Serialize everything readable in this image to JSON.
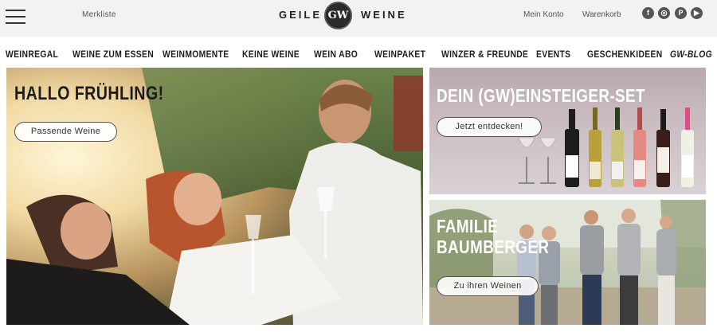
{
  "header": {
    "wishlist_label": "Merkliste",
    "logo_left": "GEILE",
    "logo_badge": "GW",
    "logo_right": "WEINE",
    "account_label": "Mein Konto",
    "cart_label": "Warenkorb",
    "social": [
      {
        "icon": "facebook-icon",
        "glyph": "f"
      },
      {
        "icon": "instagram-icon",
        "glyph": "◎"
      },
      {
        "icon": "pinterest-icon",
        "glyph": "P"
      },
      {
        "icon": "youtube-icon",
        "glyph": "▶"
      }
    ]
  },
  "nav": {
    "items": [
      {
        "label": "WEINREGAL"
      },
      {
        "label": "WEINE ZUM ESSEN"
      },
      {
        "label": "WEINMOMENTE"
      },
      {
        "label": "KEINE WEINE"
      },
      {
        "label": "WEIN ABO"
      },
      {
        "label": "WEINPAKET"
      },
      {
        "label": "WINZER & FREUNDE"
      },
      {
        "label": "EVENTS"
      },
      {
        "label": "GESCHENKIDEEN"
      },
      {
        "label": "GW-BLOG"
      }
    ]
  },
  "hero": {
    "title": "HALLO FRÜHLING!",
    "button_label": "Passende Weine"
  },
  "promo_set": {
    "title": "DEIN (GW)EINSTEIGER-SET",
    "button_label": "Jetzt entdecken!"
  },
  "promo_family": {
    "title_line1": "FAMILIE",
    "title_line2": "BAUMBERGER",
    "button_label": "Zu ihren Weinen"
  },
  "colors": {
    "header_bg": "#f2f2f2",
    "text_dark": "#1d1d1d",
    "card_set_bg": "#c9bcc1",
    "card_family_bg": "#c8cfbb"
  }
}
